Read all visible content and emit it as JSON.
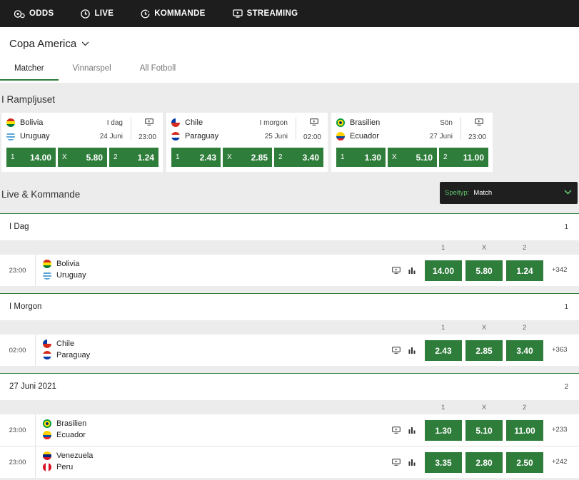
{
  "nav": [
    {
      "label": "ODDS",
      "icon": "soccer-ball-icon"
    },
    {
      "label": "LIVE",
      "icon": "clock-icon"
    },
    {
      "label": "KOMMANDE",
      "icon": "upcoming-clock-icon"
    },
    {
      "label": "STREAMING",
      "icon": "tv-icon"
    }
  ],
  "competition": "Copa America",
  "tabs": [
    "Matcher",
    "Vinnarspel",
    "All Fotboll"
  ],
  "spotlight_title": "I Rampljuset",
  "spotlight": [
    {
      "home": "Bolivia",
      "away": "Uruguay",
      "day": "I dag",
      "date": "24 Juni",
      "time": "23:00",
      "odds": [
        {
          "label": "1",
          "value": "14.00"
        },
        {
          "label": "X",
          "value": "5.80"
        },
        {
          "label": "2",
          "value": "1.24"
        }
      ]
    },
    {
      "home": "Chile",
      "away": "Paraguay",
      "day": "I morgon",
      "date": "25 Juni",
      "time": "02:00",
      "odds": [
        {
          "label": "1",
          "value": "2.43"
        },
        {
          "label": "X",
          "value": "2.85"
        },
        {
          "label": "2",
          "value": "3.40"
        }
      ]
    },
    {
      "home": "Brasilien",
      "away": "Ecuador",
      "day": "Sön",
      "date": "27 Juni",
      "time": "23:00",
      "odds": [
        {
          "label": "1",
          "value": "1.30"
        },
        {
          "label": "X",
          "value": "5.10"
        },
        {
          "label": "2",
          "value": "11.00"
        }
      ]
    }
  ],
  "live_title": "Live & Kommande",
  "bet_type": {
    "label": "Speltyp:",
    "value": "Match"
  },
  "col_labels": [
    "1",
    "X",
    "2"
  ],
  "groups": [
    {
      "title": "I Dag",
      "count": "1"
    },
    {
      "title": "I Morgon",
      "count": "1"
    },
    {
      "title": "27 Juni 2021",
      "count": "2"
    }
  ],
  "matches": [
    {
      "time": "23:00",
      "home": "Bolivia",
      "away": "Uruguay",
      "odds": [
        "14.00",
        "5.80",
        "1.24"
      ],
      "more": "+342"
    },
    {
      "time": "02:00",
      "home": "Chile",
      "away": "Paraguay",
      "odds": [
        "2.43",
        "2.85",
        "3.40"
      ],
      "more": "+363"
    },
    {
      "time": "23:00",
      "home": "Brasilien",
      "away": "Ecuador",
      "odds": [
        "1.30",
        "5.10",
        "11.00"
      ],
      "more": "+233"
    },
    {
      "time": "23:00",
      "home": "Venezuela",
      "away": "Peru",
      "odds": [
        "3.35",
        "2.80",
        "2.50"
      ],
      "more": "+242"
    }
  ],
  "colors": {
    "accent": "#2f7d3b",
    "nav_bg": "#1d1d1d",
    "dropdown_label": "#5cc36a"
  }
}
